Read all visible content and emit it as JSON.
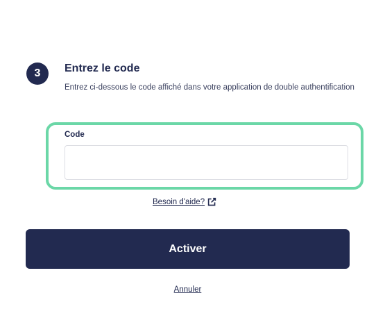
{
  "step": {
    "number": "3",
    "title": "Entrez le code",
    "description": "Entrez ci-dessous le code affiché dans votre application de double authentification"
  },
  "code_field": {
    "label": "Code",
    "value": "",
    "placeholder": ""
  },
  "help_link": {
    "label": "Besoin d'aide?",
    "icon": "external-link-icon"
  },
  "actions": {
    "activate_label": "Activer",
    "cancel_label": "Annuler"
  },
  "colors": {
    "primary": "#222a50",
    "highlight": "#6bd7a7"
  }
}
